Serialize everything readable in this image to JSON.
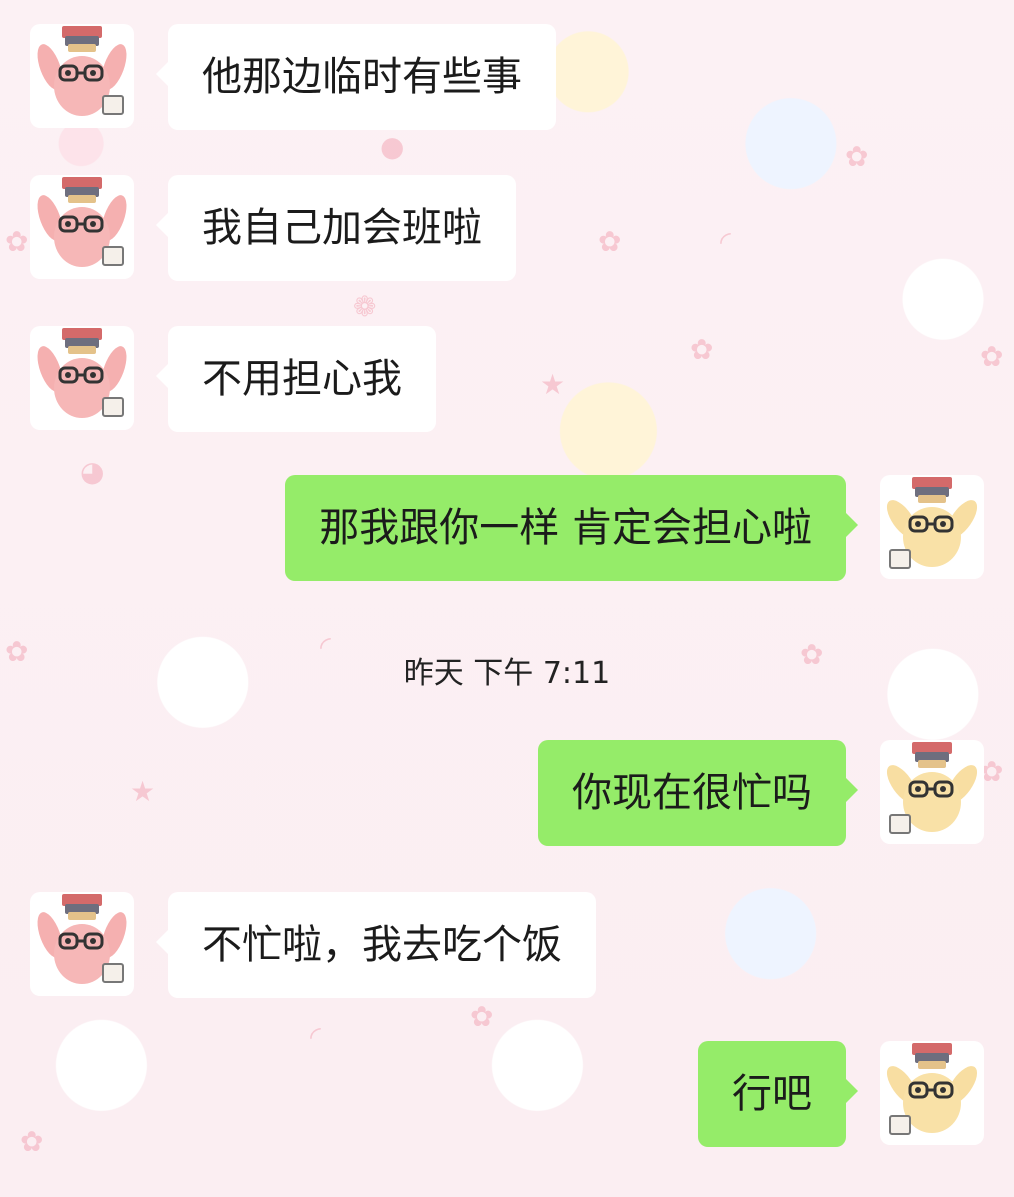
{
  "messages": [
    {
      "side": "left",
      "text": "他那边临时有些事"
    },
    {
      "side": "left",
      "text": "我自己加会班啦"
    },
    {
      "side": "left",
      "text": "不用担心我"
    },
    {
      "side": "right",
      "text": "那我跟你一样 肯定会担心啦"
    },
    {
      "side": "right",
      "text": "你现在很忙吗"
    },
    {
      "side": "left",
      "text": "不忙啦，我去吃个饭"
    },
    {
      "side": "right",
      "text": "行吧"
    }
  ],
  "timestamp": "昨天 下午 7:11",
  "colors": {
    "incoming_bubble": "#ffffff",
    "outgoing_bubble": "#95ec69",
    "text": "#1b1b1b",
    "background": "#fbeff2"
  },
  "icons": {
    "left_avatar": "pink-bunny-with-glasses-avatar-icon",
    "right_avatar": "yellow-bunny-with-glasses-avatar-icon"
  }
}
